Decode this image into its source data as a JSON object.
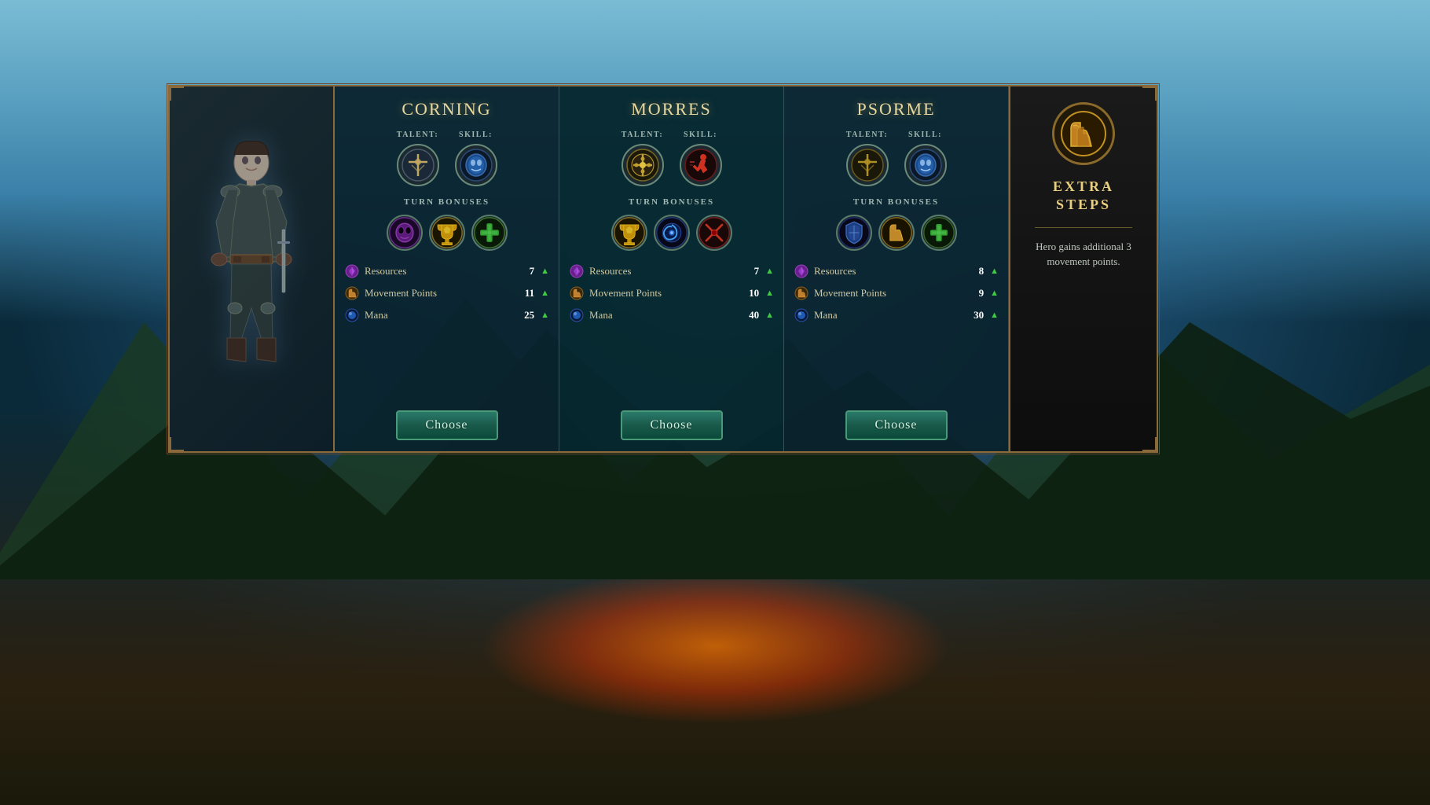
{
  "background": {
    "sky_color_top": "#7abcd4",
    "sky_color_bottom": "#3a80a8"
  },
  "columns": [
    {
      "id": "corning",
      "title": "CORNING",
      "talent_label": "TALENT:",
      "skill_label": "SKILL:",
      "talent_icon": "cross-talent",
      "skill_icon": "blue-mask-skill",
      "turn_bonuses_label": "TURN BONUSES",
      "bonus_icons": [
        "purple-mask",
        "trophy-gold",
        "green-cross"
      ],
      "stats": [
        {
          "name": "Resources",
          "value": "7",
          "icon": "purple-gem"
        },
        {
          "name": "Movement Points",
          "value": "11",
          "icon": "boot-gold"
        },
        {
          "name": "Mana",
          "value": "25",
          "icon": "blue-orb"
        }
      ],
      "choose_label": "Choose"
    },
    {
      "id": "morres",
      "title": "MORRES",
      "talent_label": "TALENT:",
      "skill_label": "SKILL:",
      "talent_icon": "ornate-cross-talent",
      "skill_icon": "red-runner-skill",
      "turn_bonuses_label": "TURN BONUSES",
      "bonus_icons": [
        "trophy-gold",
        "blue-swirl",
        "red-cross"
      ],
      "stats": [
        {
          "name": "Resources",
          "value": "7",
          "icon": "purple-gem"
        },
        {
          "name": "Movement Points",
          "value": "10",
          "icon": "boot-gold"
        },
        {
          "name": "Mana",
          "value": "40",
          "icon": "blue-orb"
        }
      ],
      "choose_label": "Choose"
    },
    {
      "id": "psorme",
      "title": "PSORME",
      "talent_label": "TALENT:",
      "skill_label": "SKILL:",
      "talent_icon": "cross-talent",
      "skill_icon": "blue-mask-skill",
      "turn_bonuses_label": "TURN BONUSES",
      "bonus_icons": [
        "blue-shield",
        "gold-boots",
        "green-plus"
      ],
      "stats": [
        {
          "name": "Resources",
          "value": "8",
          "icon": "purple-gem"
        },
        {
          "name": "Movement Points",
          "value": "9",
          "icon": "boot-gold"
        },
        {
          "name": "Mana",
          "value": "30",
          "icon": "blue-orb"
        }
      ],
      "choose_label": "Choose"
    }
  ],
  "extra_panel": {
    "title": "EXTRA\nSTEPS",
    "icon": "golden-boots",
    "description": "Hero gains additional 3 movement points."
  }
}
